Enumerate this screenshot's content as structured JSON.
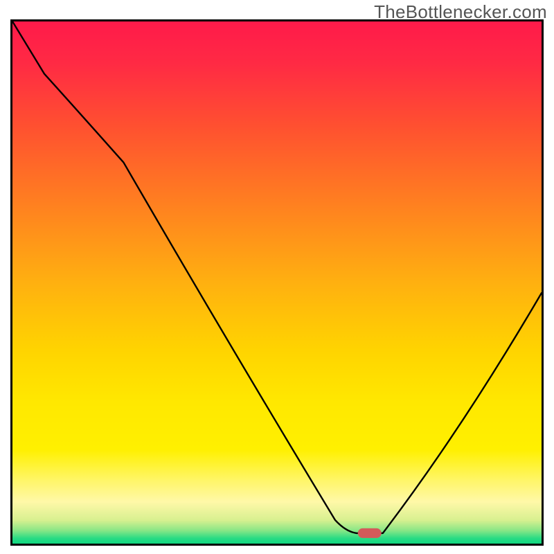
{
  "watermark": "TheBottlenecker.com",
  "chart_data": {
    "type": "line",
    "title": "",
    "xlabel": "",
    "ylabel": "",
    "xlim": [
      0,
      100
    ],
    "ylim": [
      0,
      100
    ],
    "x": [
      0,
      6,
      21,
      61,
      65,
      70,
      100
    ],
    "values": [
      100,
      90,
      73,
      4.5,
      2,
      2,
      48
    ],
    "marker": {
      "x": 67.5,
      "y": 2,
      "color": "#d45a5a"
    },
    "gradient_stops": [
      {
        "offset": 0.0,
        "color": "#ff1a4a"
      },
      {
        "offset": 0.08,
        "color": "#ff2a44"
      },
      {
        "offset": 0.2,
        "color": "#ff5030"
      },
      {
        "offset": 0.35,
        "color": "#ff8020"
      },
      {
        "offset": 0.5,
        "color": "#ffb010"
      },
      {
        "offset": 0.63,
        "color": "#ffd400"
      },
      {
        "offset": 0.73,
        "color": "#ffe800"
      },
      {
        "offset": 0.82,
        "color": "#fff000"
      },
      {
        "offset": 0.88,
        "color": "#fff66a"
      },
      {
        "offset": 0.92,
        "color": "#fff8a8"
      },
      {
        "offset": 0.955,
        "color": "#d8f090"
      },
      {
        "offset": 0.975,
        "color": "#88e686"
      },
      {
        "offset": 0.99,
        "color": "#28db84"
      },
      {
        "offset": 1.0,
        "color": "#10d880"
      }
    ]
  }
}
